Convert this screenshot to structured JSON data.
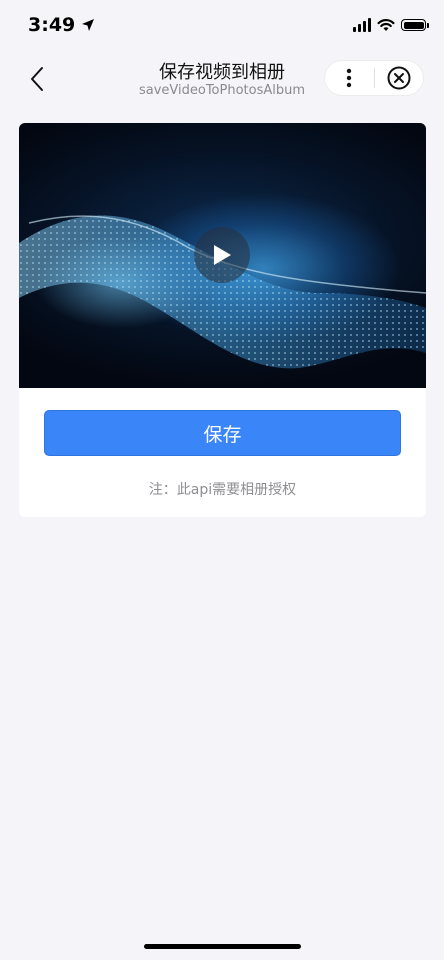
{
  "status_bar": {
    "time": "3:49",
    "icons": [
      "location-arrow-icon",
      "cellular-signal-icon",
      "wifi-icon",
      "battery-icon"
    ],
    "battery_level": 1.0
  },
  "nav": {
    "title": "保存视频到相册",
    "subtitle": "saveVideoToPhotosAlbum",
    "back_icon": "chevron-left-icon",
    "more_icon": "more-vertical-icon",
    "close_icon": "close-circle-icon"
  },
  "video": {
    "play_icon": "play-icon"
  },
  "actions": {
    "save_label": "保存"
  },
  "note": "注：此api需要相册授权",
  "colors": {
    "page_background": "#f5f4f8",
    "primary_button": "#3a85f7",
    "note_text": "#8e8e93"
  }
}
